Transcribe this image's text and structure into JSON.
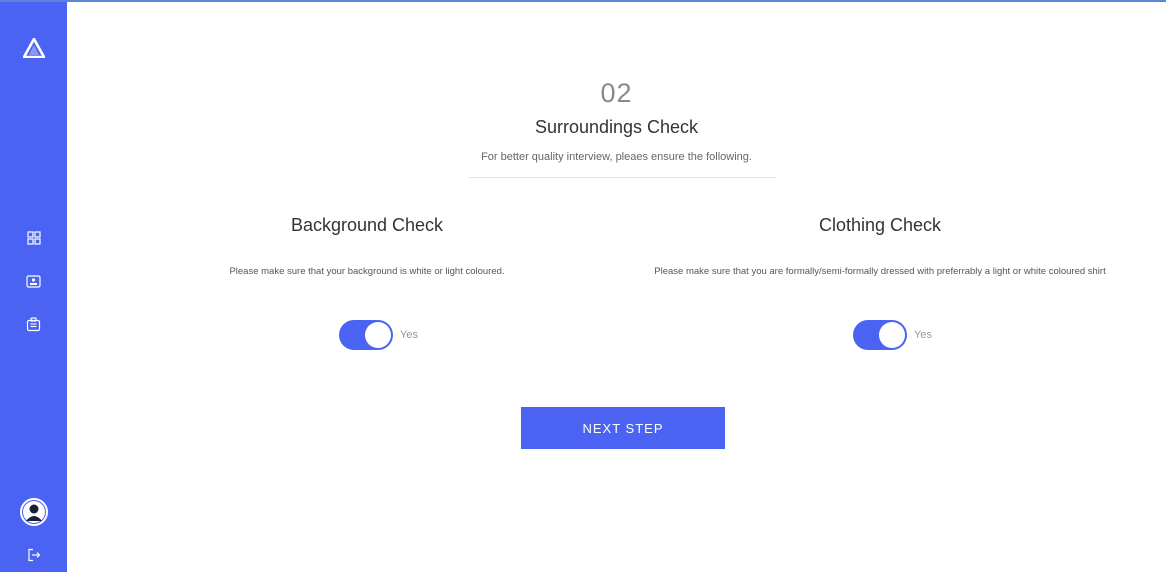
{
  "sidebar": {
    "icons": [
      "logo-triangle-icon",
      "dashboard-grid-icon",
      "id-card-icon",
      "briefcase-icon",
      "user-avatar-icon",
      "logout-icon"
    ]
  },
  "step": {
    "number": "02",
    "title": "Surroundings Check",
    "subtitle": "For better quality interview, pleaes ensure the following."
  },
  "checks": [
    {
      "title": "Background Check",
      "description": "Please make sure that your background is white or light coloured.",
      "toggle_label": "Yes",
      "toggle_on": true
    },
    {
      "title": "Clothing Check",
      "description": "Please make sure that you are formally/semi-formally dressed with preferrably a light or white coloured shirt",
      "toggle_label": "Yes",
      "toggle_on": true
    }
  ],
  "next_button_label": "NEXT STEP",
  "colors": {
    "accent": "#4a63f3",
    "sidebar": "#4a63f3"
  }
}
